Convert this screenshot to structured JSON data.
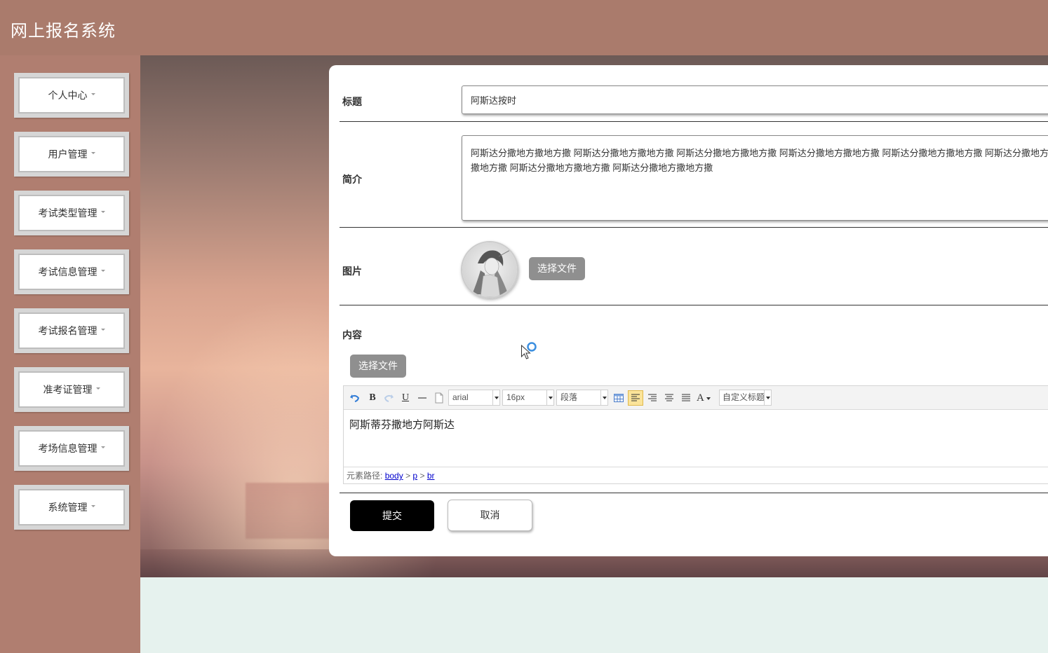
{
  "app": {
    "title": "网上报名系统"
  },
  "sidebar": {
    "items": [
      {
        "label": "个人中心"
      },
      {
        "label": "用户管理"
      },
      {
        "label": "考试类型管理"
      },
      {
        "label": "考试信息管理"
      },
      {
        "label": "考试报名管理"
      },
      {
        "label": "准考证管理"
      },
      {
        "label": "考场信息管理"
      },
      {
        "label": "系统管理"
      }
    ]
  },
  "form": {
    "title_label": "标题",
    "title_value": "阿斯达按时",
    "intro_label": "简介",
    "intro_value": "阿斯达分撒地方撒地方撒 阿斯达分撒地方撒地方撒 阿斯达分撒地方撒地方撒 阿斯达分撒地方撒地方撒 阿斯达分撒地方撒地方撒 阿斯达分撒地方撒地方撒 阿斯达分撒地方撒地方撒 阿斯达分撒地方撒地方撒",
    "image_label": "图片",
    "image_button": "选择文件",
    "content_label": "内容",
    "content_button": "选择文件",
    "submit": "提交",
    "cancel": "取消"
  },
  "editor": {
    "font_family": "arial",
    "font_size": "16px",
    "paragraph": "段落",
    "custom_title": "自定义标题",
    "bold": "B",
    "underline": "U",
    "font_color": "A",
    "content": "阿斯蒂芬撒地方阿斯达",
    "path_label": "元素路径:",
    "path": [
      "body",
      "p",
      "br"
    ],
    "path_sep": ">"
  },
  "colors": {
    "header_bg": "#aa7b6c",
    "sidebar_bg": "#b07e70",
    "submit_bg": "#000000",
    "file_button_bg": "#8f8f8f"
  }
}
